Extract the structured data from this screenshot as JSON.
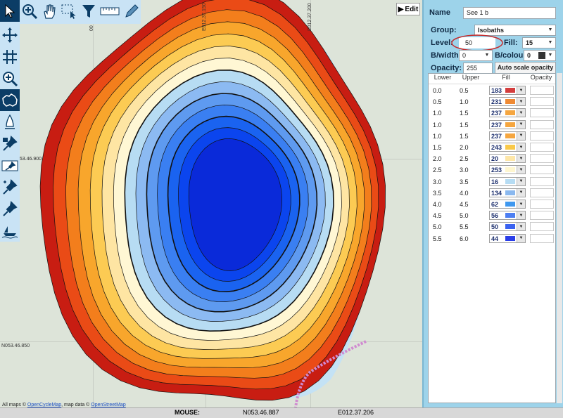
{
  "map": {
    "grid_labels": {
      "lon_1": "E012.37.150",
      "lon_2": "E012.37.200",
      "lon_3": "00",
      "lat_1": "053.46.900",
      "lat_2": "N053.46.850"
    },
    "attribution": {
      "prefix": "All maps ©",
      "link1": "OpenCycleMap",
      "middle": ", map data ©",
      "link2": "OpenStreetMap"
    },
    "edit_button": "Edit"
  },
  "toolbar": {
    "top_tools": [
      "pointer-tool",
      "zoom-in-tool",
      "pan-hand-tool",
      "select-area-tool",
      "filter-tool",
      "measure-tool",
      "pen-tool"
    ],
    "left_tools": [
      "move-tool",
      "grid-tool",
      "zoom-tool",
      "region-tool",
      "buoy-tool",
      "pin-lock-tool",
      "mark-tool",
      "pins-tool",
      "pin-tool",
      "boat-tool"
    ]
  },
  "panel": {
    "name_label": "Name",
    "name_value": "See 1 b",
    "group_label": "Group:",
    "group_value": "Isobaths",
    "level_label": "Level:",
    "level_value": "50",
    "fill_label": "Fill:",
    "fill_value": "15",
    "bwidth_label": "B/width:",
    "bwidth_value": "0",
    "bcolour_label": "B/colour:",
    "bcolour_value": "0",
    "opacity_label": "Opacity:",
    "opacity_value": "255",
    "auto_scale_label": "Auto scale opacity",
    "table": {
      "headers": [
        "Lower",
        "Upper",
        "Fill",
        "Opacity"
      ],
      "rows": [
        {
          "lower": "0.0",
          "upper": "0.5",
          "fill": "183",
          "color": "#d43d3d"
        },
        {
          "lower": "0.5",
          "upper": "1.0",
          "fill": "231",
          "color": "#ef8a34"
        },
        {
          "lower": "1.0",
          "upper": "1.5",
          "fill": "237",
          "color": "#f5a640"
        },
        {
          "lower": "1.0",
          "upper": "1.5",
          "fill": "237",
          "color": "#f5a640"
        },
        {
          "lower": "1.0",
          "upper": "1.5",
          "fill": "237",
          "color": "#f5a640"
        },
        {
          "lower": "1.5",
          "upper": "2.0",
          "fill": "243",
          "color": "#f9c94a"
        },
        {
          "lower": "2.0",
          "upper": "2.5",
          "fill": "20",
          "color": "#fde6a8"
        },
        {
          "lower": "2.5",
          "upper": "3.0",
          "fill": "253",
          "color": "#fef6cf"
        },
        {
          "lower": "3.0",
          "upper": "3.5",
          "fill": "16",
          "color": "#b6dcf3"
        },
        {
          "lower": "3.5",
          "upper": "4.0",
          "fill": "134",
          "color": "#8ab8ef"
        },
        {
          "lower": "4.0",
          "upper": "4.5",
          "fill": "62",
          "color": "#3f98ef"
        },
        {
          "lower": "4.5",
          "upper": "5.0",
          "fill": "56",
          "color": "#4d7ff2"
        },
        {
          "lower": "5.0",
          "upper": "5.5",
          "fill": "50",
          "color": "#3a62f0"
        },
        {
          "lower": "5.5",
          "upper": "6.0",
          "fill": "44",
          "color": "#2a3ee8"
        }
      ]
    }
  },
  "status_bar": {
    "mouse_label": "MOUSE:",
    "lat": "N053.46.887",
    "lon": "E012.37.206"
  },
  "contour_colors": [
    "#c81d12",
    "#ea4b16",
    "#f37e1c",
    "#f8a62c",
    "#fccb53",
    "#fee5a3",
    "#fff7d4",
    "#b7dcf3",
    "#8cbaf2",
    "#5e9af0",
    "#3a7ff2",
    "#1a63f0",
    "#0b45ee",
    "#0a2ad9"
  ]
}
